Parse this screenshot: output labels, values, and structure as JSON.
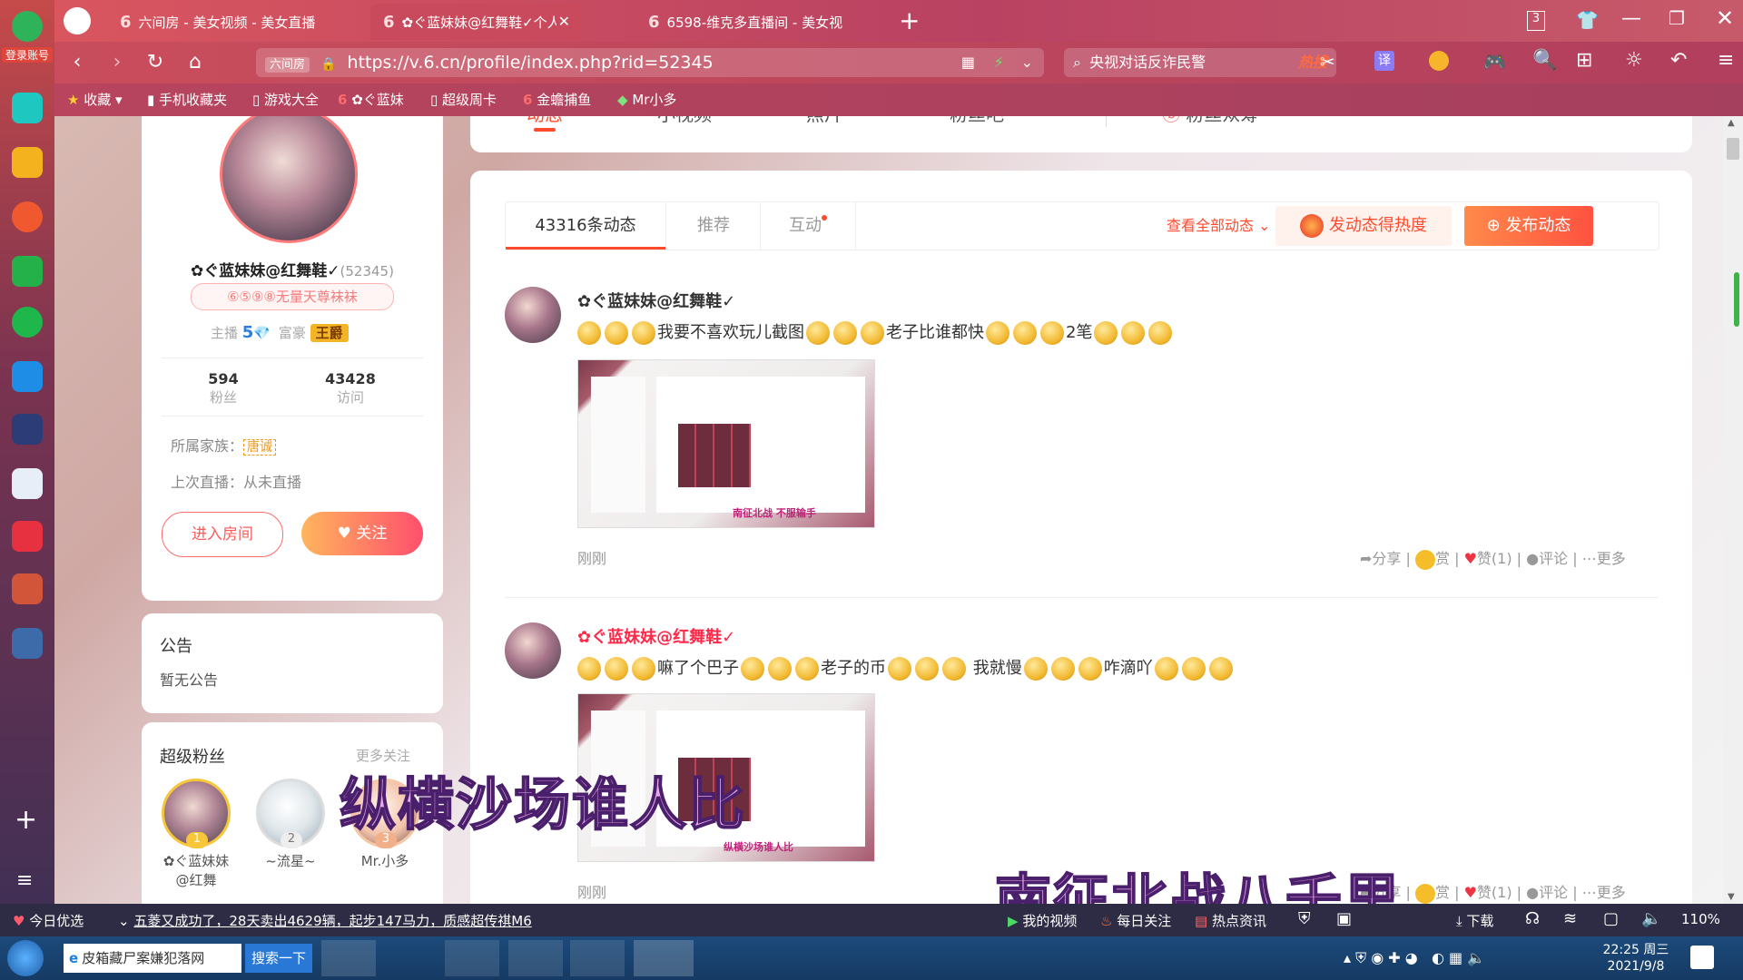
{
  "dock": {
    "login_label": "登录账号"
  },
  "tabs": [
    {
      "title": "六间房 - 美女视频 - 美女直播",
      "active": false
    },
    {
      "title": "✿ぐ蓝妹妹@红舞鞋✓个人动态",
      "active": true
    },
    {
      "title": "6598-维克多直播间 - 美女视",
      "active": false
    }
  ],
  "window": {
    "tab_count": "3"
  },
  "address": {
    "prefix": "六间房",
    "url": "https://v.6.cn/profile/index.php?rid=52345"
  },
  "search": {
    "text": "央视对话反诈民警",
    "hot_label": "热搜"
  },
  "bookmarks": [
    "收藏",
    "手机收藏夹",
    "游戏大全",
    "✿ぐ蓝妹",
    "超级周卡",
    "金蟾捕鱼",
    "Mr小多"
  ],
  "profile_nav": [
    "动态",
    "小视频",
    "照片",
    "粉丝吧",
    "粉丝众筹"
  ],
  "profile": {
    "name": "✿ぐ蓝妹妹@红舞鞋✓",
    "rid": "(52345)",
    "badge": "⑥⑤⑨⑧无量天尊袜袜",
    "anchor_label": "主播",
    "anchor_level": "5",
    "rich_label": "富豪",
    "rich_badge": "王爵",
    "fans_count": "594",
    "fans_label": "粉丝",
    "visit_count": "43428",
    "visit_label": "访问",
    "family_label": "所属家族：",
    "family_value": "唐诚",
    "last_live": "上次直播：从未直播",
    "enter_room": "进入房间",
    "follow": "关注"
  },
  "notice": {
    "title": "公告",
    "text": "暂无公告"
  },
  "superfans": {
    "title": "超级粉丝",
    "more": "更多关注",
    "fans": [
      {
        "rank": "1",
        "name": "✿ぐ蓝妹妹@红舞"
      },
      {
        "rank": "2",
        "name": "~流星~"
      },
      {
        "rank": "3",
        "name": "Mr.小多"
      }
    ]
  },
  "feed": {
    "tabs": [
      "43316条动态",
      "推荐",
      "互动"
    ],
    "view_all": "查看全部动态",
    "hot_button": "发动态得热度",
    "post_button": "发布动态",
    "posts": [
      {
        "author": "✿ぐ蓝妹妹@红舞鞋✓",
        "text1": "我要不喜欢玩儿截图",
        "text2": "老子比谁都快",
        "text3": "2笔",
        "time": "刚刚",
        "thumb_caption": "南征北战 不服输手"
      },
      {
        "author": "✿ぐ蓝妹妹@红舞鞋✓",
        "text1": "嘛了个巴子",
        "text2": "老子的币",
        "text3": "我就慢",
        "text4": "咋滴吖",
        "time": "刚刚",
        "thumb_caption": "纵横沙场谁人比"
      }
    ],
    "actions": {
      "share": "分享",
      "reward": "赏",
      "like": "赞(1)",
      "comment": "评论",
      "more": "更多"
    }
  },
  "overlays": {
    "text1": "纵横沙场谁人比",
    "text2": "南征北战八千里"
  },
  "status": {
    "news_label": "今日优选",
    "news": "五菱又成功了，28天卖出4629辆，起步147马力，质感超传祺M6",
    "my_video": "我的视频",
    "daily": "每日关注",
    "hot_news": "热点资讯",
    "download": "下载",
    "zoom": "110%"
  },
  "taskbar": {
    "ie_text": "皮箱藏尸案嫌犯落网",
    "search_btn": "搜索一下",
    "time": "22:25 周三",
    "date": "2021/9/8"
  },
  "colors": {
    "accent": "#ff5b3a",
    "brand": "#e8436a",
    "link": "#ff4a2d"
  }
}
